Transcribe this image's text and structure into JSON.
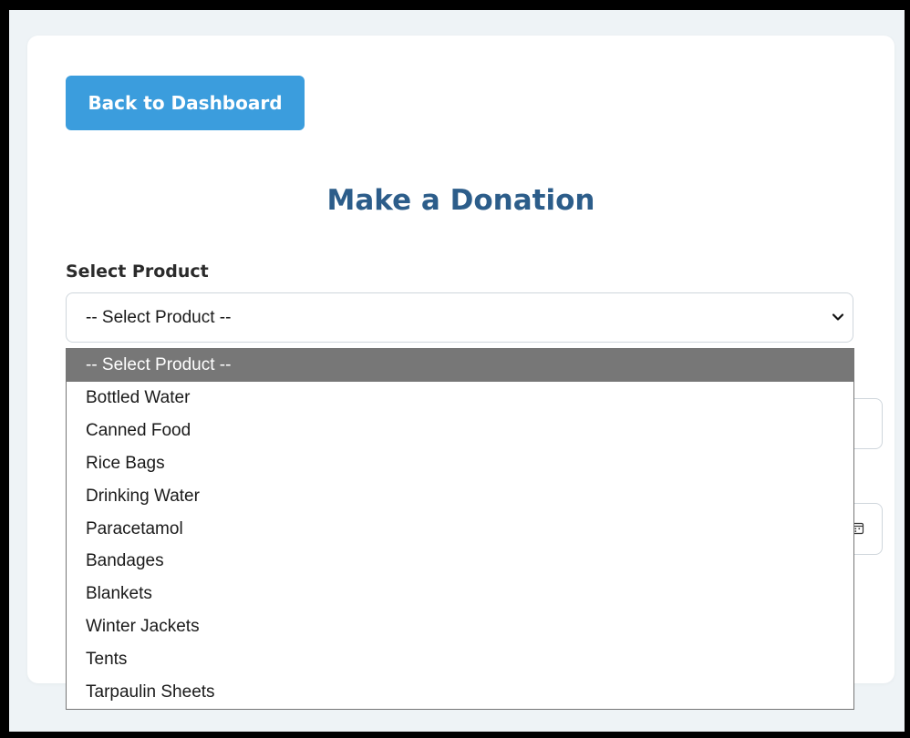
{
  "form": {
    "back_button_label": "Back to Dashboard",
    "title": "Make a Donation",
    "product_label": "Select Product",
    "product_select_value": "-- Select Product --"
  },
  "dropdown": {
    "options": [
      {
        "label": "-- Select Product --",
        "selected": true
      },
      {
        "label": "Bottled Water"
      },
      {
        "label": "Canned Food"
      },
      {
        "label": "Rice Bags"
      },
      {
        "label": "Drinking Water"
      },
      {
        "label": "Paracetamol"
      },
      {
        "label": "Bandages"
      },
      {
        "label": "Blankets"
      },
      {
        "label": "Winter Jackets"
      },
      {
        "label": "Tents"
      },
      {
        "label": "Tarpaulin Sheets"
      }
    ]
  },
  "icons": {
    "select_chevron": "chevron-down-icon",
    "date_picker": "calendar-icon"
  },
  "colors": {
    "primary_button": "#3b9ddd",
    "title": "#2c5d8a",
    "selected_option_bg": "#777777",
    "page_bg": "#eef3f6"
  }
}
